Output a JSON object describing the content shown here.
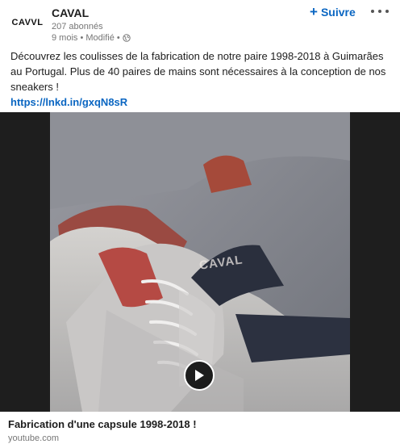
{
  "post": {
    "author": {
      "logo_text": "CAVVL",
      "name": "CAVAL",
      "followers": "207 abonnés",
      "timestamp": "9 mois • Modifié •"
    },
    "follow_label": "Suivre",
    "follow_icon": "plus-icon",
    "more_icon": "more-options-icon",
    "body_text": "Découvrez les coulisses de la fabrication de notre paire 1998-2018 à Guimarães au Portugal. Plus de 40 paires de mains sont nécessaires à la conception de nos sneakers !",
    "link_text": "https://lnkd.in/gxqN8sR",
    "link_color": "#0a66c2"
  },
  "video": {
    "overlay_text": "CAVAL",
    "play_icon": "play-icon"
  },
  "card": {
    "title": "Fabrication d'une capsule 1998-2018 !",
    "source": "youtube.com"
  }
}
